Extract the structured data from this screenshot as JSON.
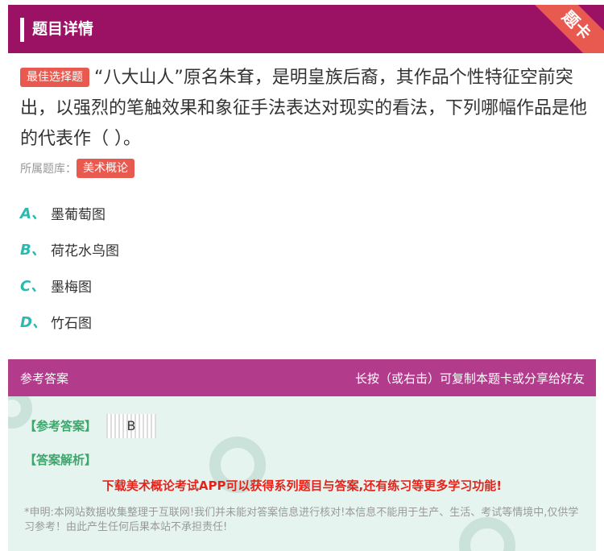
{
  "header": {
    "title": "题目详情",
    "ribbon": "题卡"
  },
  "question": {
    "type_badge": "最佳选择题",
    "text": "“八大山人”原名朱耷，是明皇族后裔，其作品个性特征空前突出，以强烈的笔触效果和象征手法表达对现实的看法，下列哪幅作品是他的代表作（ ）。",
    "bank_label": "所属题库：",
    "bank_tag": "美术概论"
  },
  "options": [
    {
      "letter": "A、",
      "text": "墨葡萄图"
    },
    {
      "letter": "B、",
      "text": "荷花水鸟图"
    },
    {
      "letter": "C、",
      "text": "墨梅图"
    },
    {
      "letter": "D、",
      "text": "竹石图"
    }
  ],
  "answer": {
    "section_title": "参考答案",
    "share_hint": "长按（或右击）可复制本题卡或分享给好友",
    "answer_label": "【参考答案】",
    "answer_value": "B",
    "analysis_label": "【答案解析】",
    "promo": "下载美术概论考试APP可以获得系列题目与答案,还有练习等更多学习功能!",
    "disclaimer": "*申明:本网站数据收集整理于互联网!我们并未能对答案信息进行核对!本信息不能用于生产、生活、考试等情境中,仅供学习参考！由此产生任何后果本站不承担责任!"
  },
  "colors": {
    "header": "#9b1163",
    "answer_header": "#b33b8c",
    "accent_red": "#e85a4f",
    "option_letter": "#2bb9b0",
    "answer_green": "#3aa86b"
  }
}
